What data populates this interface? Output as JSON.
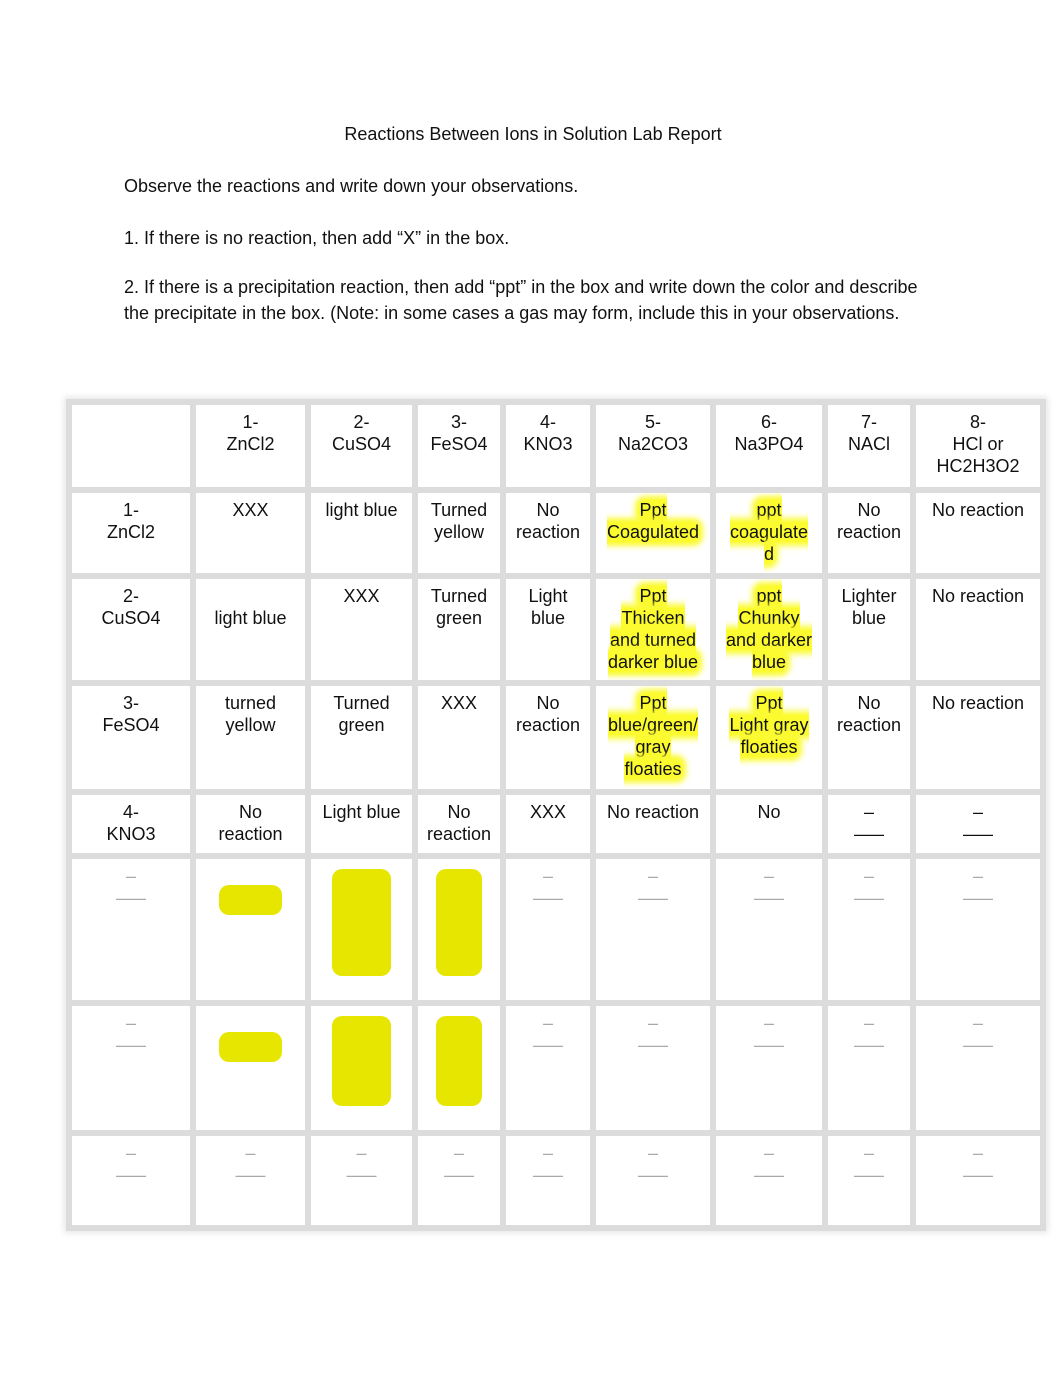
{
  "document": {
    "title": "Reactions Between Ions in Solution Lab Report",
    "paragraphs": [
      "Observe the reactions and write down your observations.",
      "1. If there is no reaction, then add “X” in the box.",
      "2. If there is a precipitation reaction, then add “ppt” in the box and write down the color and describe the precipitate in the box. (Note: in some cases a gas may form, include this in your observations."
    ]
  },
  "table": {
    "highlight_color": "#fbfb30",
    "columns": [
      "",
      "1-\nZnCl2",
      "2-\nCuSO4",
      "3-\nFeSO4",
      "4-\nKNO3",
      "5-\nNa2CO3",
      "6-\nNa3PO4",
      "7-\nNACl",
      "8-\nHCl or\nHC2H3O2"
    ],
    "rows": [
      {
        "label": "1-\nZnCl2",
        "cells": [
          {
            "text": "XXX",
            "highlight": false
          },
          {
            "text": "light blue",
            "highlight": false
          },
          {
            "text": "Turned\nyellow",
            "highlight": false
          },
          {
            "text": "No\nreaction",
            "highlight": false
          },
          {
            "text": "Ppt\nCoagulated",
            "highlight": true
          },
          {
            "text": "ppt\ncoagulate\nd",
            "highlight": true
          },
          {
            "text": "No\nreaction",
            "highlight": false
          },
          {
            "text": "No reaction",
            "highlight": false
          }
        ]
      },
      {
        "label": "2-\nCuSO4",
        "cells": [
          {
            "text": "\nlight blue",
            "highlight": false
          },
          {
            "text": "XXX",
            "highlight": false
          },
          {
            "text": "Turned\ngreen",
            "highlight": false
          },
          {
            "text": "Light\nblue",
            "highlight": false
          },
          {
            "text": "Ppt\nThicken\nand turned\ndarker blue",
            "highlight": true
          },
          {
            "text": "ppt\nChunky\nand darker\nblue",
            "highlight": true
          },
          {
            "text": "Lighter\nblue",
            "highlight": false
          },
          {
            "text": "No reaction",
            "highlight": false
          }
        ]
      },
      {
        "label": "3-\nFeSO4",
        "cells": [
          {
            "text": "turned\nyellow",
            "highlight": false
          },
          {
            "text": "Turned\ngreen",
            "highlight": false
          },
          {
            "text": "XXX",
            "highlight": false
          },
          {
            "text": "No\nreaction",
            "highlight": false
          },
          {
            "text": "Ppt\nblue/green/\ngray\nfloaties",
            "highlight": true
          },
          {
            "text": "Ppt\nLight gray\nfloaties",
            "highlight": true
          },
          {
            "text": "No\nreaction",
            "highlight": false
          },
          {
            "text": "No reaction",
            "highlight": false
          }
        ]
      },
      {
        "label": "4-\nKNO3",
        "cells": [
          {
            "text": "No\nreaction",
            "highlight": false
          },
          {
            "text": "Light blue",
            "highlight": false
          },
          {
            "text": "No\nreaction",
            "highlight": false
          },
          {
            "text": "XXX",
            "highlight": false
          },
          {
            "text": "No reaction",
            "highlight": false
          },
          {
            "text": "No",
            "highlight": false
          }
        ]
      }
    ]
  }
}
